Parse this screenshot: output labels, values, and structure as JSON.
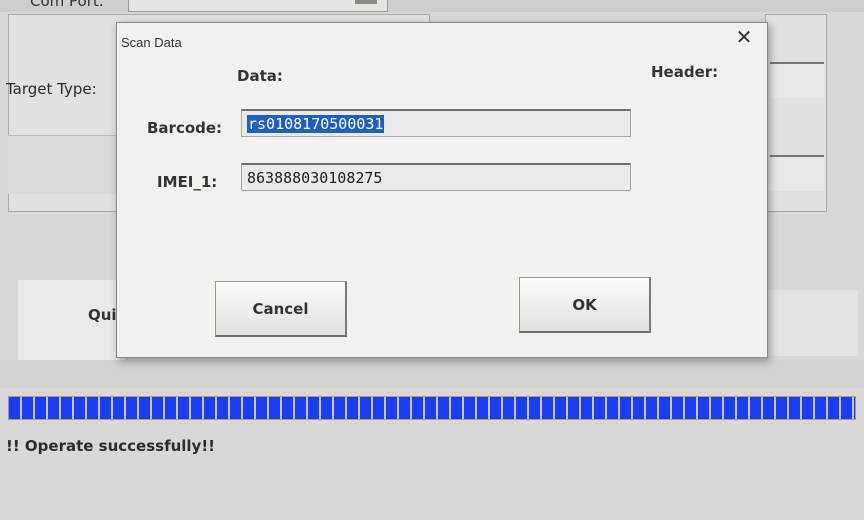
{
  "background": {
    "com_label": "Com Port:",
    "target_type_label": "Target Type:",
    "quit_label": "Quit",
    "progress_percent": 100,
    "status_text": "!! Operate successfully!!"
  },
  "dialog": {
    "title": "Scan Data",
    "close_icon": "close-icon",
    "data_heading": "Data:",
    "header_heading": "Header:",
    "fields": [
      {
        "label": "Barcode:",
        "value": "rs0108170500031",
        "selected": true
      },
      {
        "label": "IMEI_1:",
        "value": "863888030108275",
        "selected": false
      }
    ],
    "cancel_label": "Cancel",
    "ok_label": "OK"
  },
  "colors": {
    "progress": "#1a3df5",
    "selection": "#1d5fc4"
  }
}
